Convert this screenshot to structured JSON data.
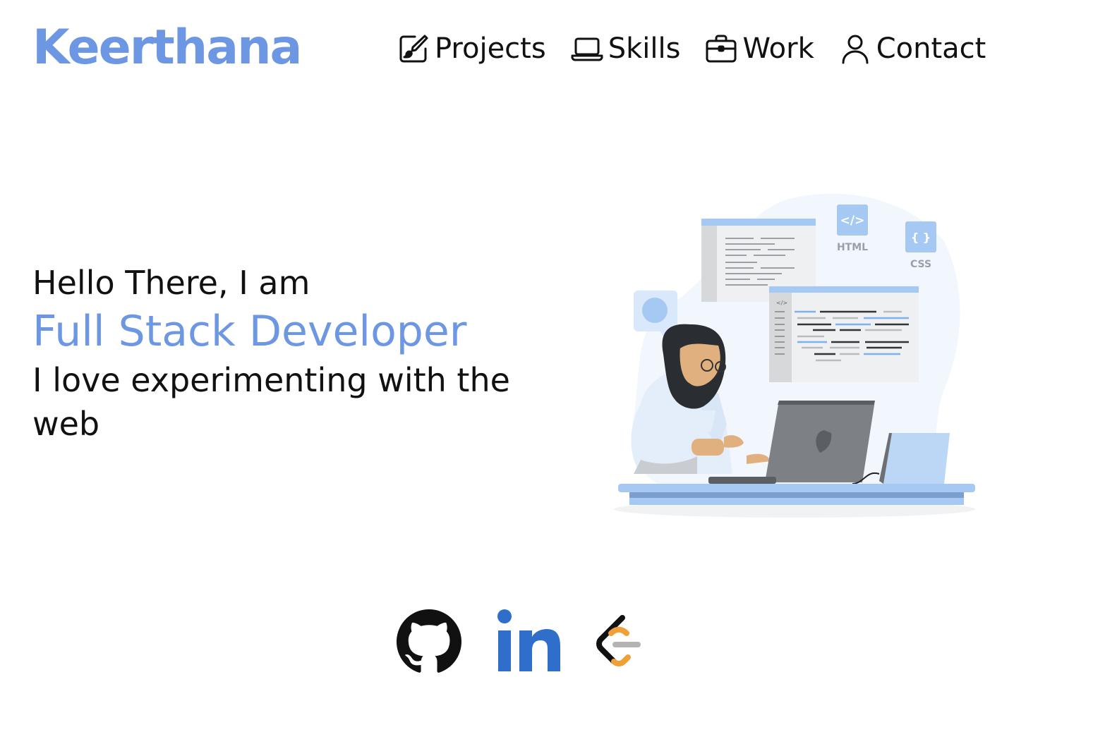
{
  "brand": {
    "name": "Keerthana",
    "color": "#6d97e3"
  },
  "nav": {
    "items": [
      {
        "label": "Projects",
        "icon": "brush-square-icon"
      },
      {
        "label": "Skills",
        "icon": "laptop-icon"
      },
      {
        "label": "Work",
        "icon": "briefcase-icon"
      },
      {
        "label": "Contact",
        "icon": "person-icon"
      }
    ]
  },
  "hero": {
    "greeting": "Hello There, I am",
    "role": "Full Stack Developer",
    "tagline": "I love experimenting with the web",
    "illustration": {
      "html_label": "HTML",
      "css_label": "CSS",
      "html_tag": "</>",
      "css_tag": "{ }",
      "code_tag": "</>"
    }
  },
  "socials": [
    {
      "name": "GitHub",
      "icon": "github-icon"
    },
    {
      "name": "LinkedIn",
      "icon": "linkedin-icon"
    },
    {
      "name": "LeetCode",
      "icon": "leetcode-icon"
    }
  ],
  "colors": {
    "accent": "#6d97e3",
    "linkedin": "#2f6fcb",
    "leetcode_orange": "#f0a036",
    "text": "#111111"
  }
}
